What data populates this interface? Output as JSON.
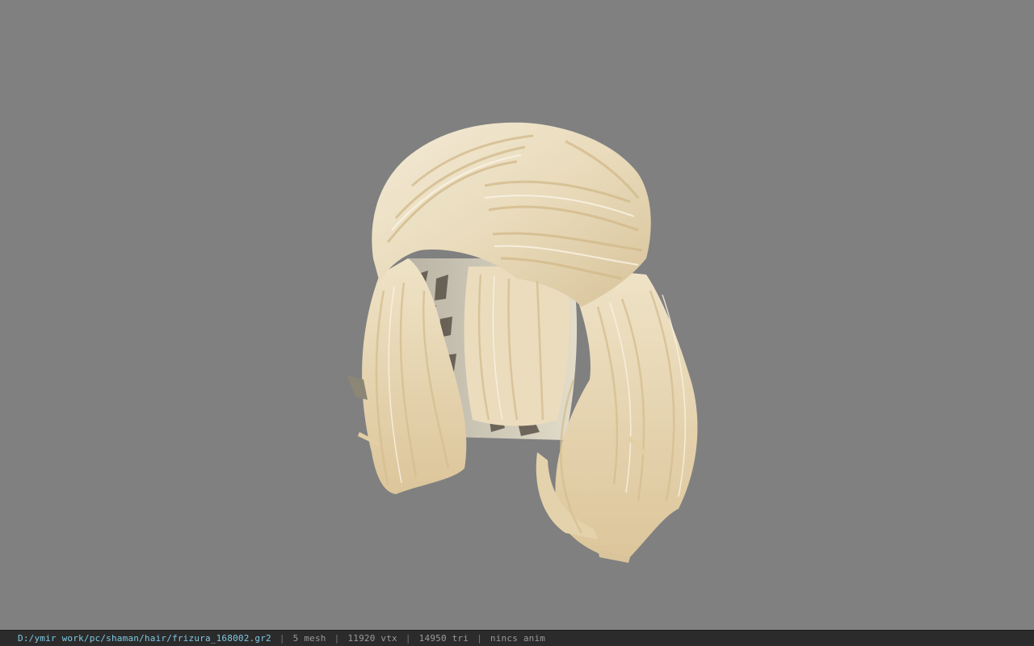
{
  "viewer": {
    "background_color": "#808080",
    "model_icon": "hair-mesh-model"
  },
  "status": {
    "file_path": "D:/ymir work/pc/shaman/hair/frizura_168002.gr2",
    "separator": "|",
    "mesh": "5 mesh",
    "vtx": "11920 vtx",
    "tri": "14950 tri",
    "anim": "nincs anim"
  }
}
